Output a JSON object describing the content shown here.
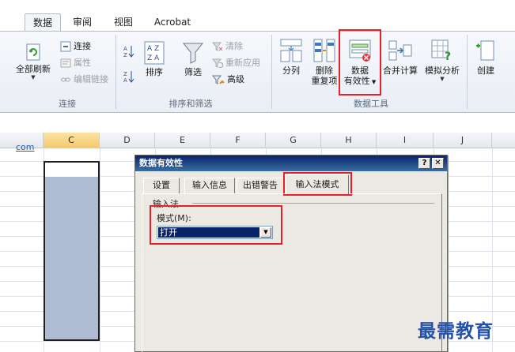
{
  "tabs": [
    "数据",
    "审阅",
    "视图",
    "Acrobat"
  ],
  "ribbon": {
    "connections": {
      "refresh_all": "全部刷新",
      "connections": "连接",
      "properties": "属性",
      "edit_links": "编辑链接",
      "group_label": "连接"
    },
    "sort_filter": {
      "sort": "排序",
      "filter": "筛选",
      "clear": "清除",
      "reapply": "重新应用",
      "advanced": "高级",
      "group_label": "排序和筛选"
    },
    "data_tools": {
      "text_to_columns": "分列",
      "remove_duplicates_1": "删除",
      "remove_duplicates_2": "重复项",
      "data_validation_1": "数据",
      "data_validation_2": "有效性",
      "consolidate": "合并计算",
      "what_if": "模拟分析",
      "group_label": "数据工具"
    },
    "outline": {
      "create": "创建"
    }
  },
  "sheet": {
    "columns": [
      "C",
      "D",
      "E",
      "F",
      "G",
      "H",
      "I",
      "J"
    ],
    "selected_column": "C",
    "cell_fragment": "com"
  },
  "dialog": {
    "title": "数据有效性",
    "help_btn": "?",
    "close_btn": "✕",
    "tabs": [
      "设置",
      "输入信息",
      "出错警告",
      "输入法模式"
    ],
    "active_tab": "输入法模式",
    "section_title": "输入法",
    "mode_label": "模式(M):",
    "mode_value": "打开"
  },
  "watermark": "最需教育",
  "colors": {
    "highlight": "#e8202a",
    "selection_fill": "#aebbd3",
    "dialog_title": "#0a246a"
  }
}
